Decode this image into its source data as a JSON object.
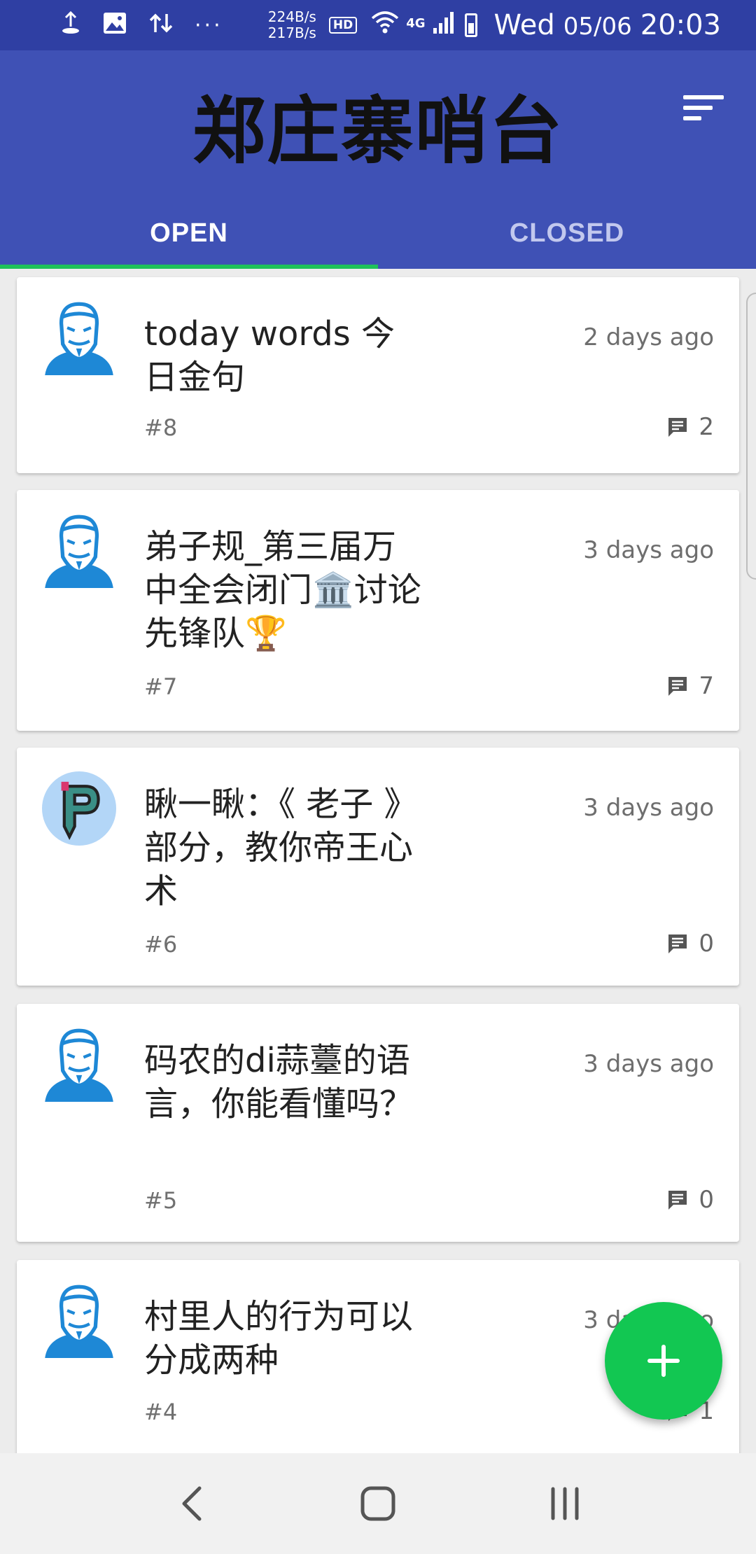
{
  "status_bar": {
    "net_up": "224B/s",
    "net_down": "217B/s",
    "hd_badge": "HD",
    "network": "4G",
    "day": "Wed",
    "date": "05/06",
    "time": "20:03",
    "icons": [
      "upload-icon",
      "image-icon",
      "data-transfer-icon",
      "more-dots-icon",
      "wifi-icon",
      "signal-icon",
      "battery-icon"
    ]
  },
  "header": {
    "title": "郑庄寨哨台",
    "sort_icon": "sort-icon"
  },
  "tabs": [
    {
      "label": "OPEN",
      "active": true
    },
    {
      "label": "CLOSED",
      "active": false
    }
  ],
  "issues": [
    {
      "title": "today words 今日金句",
      "time": "2 days ago",
      "number": "#8",
      "comments": "2",
      "avatar": "anonymous-mask"
    },
    {
      "title": "弟子规_第三届万中全会闭门🏛️讨论先锋队🏆",
      "time": "3 days ago",
      "number": "#7",
      "comments": "7",
      "avatar": "anonymous-mask"
    },
    {
      "title": " 瞅一瞅：《 老子 》部分，教你帝王心术",
      "time": "3 days ago",
      "number": "#6",
      "comments": "0",
      "avatar": "p-pencil"
    },
    {
      "title": "码农的di蒜薹的语言，你能看懂吗？",
      "time": "3 days ago",
      "number": "#5",
      "comments": "0",
      "avatar": "anonymous-mask"
    },
    {
      "title": "村里人的行为可以分成两种",
      "time": "3 days ago",
      "number": "#4",
      "comments": "1",
      "avatar": "anonymous-mask"
    }
  ],
  "fab": {
    "label": "+"
  },
  "colors": {
    "status_bar": "#2f3fa3",
    "app_bar": "#3f51b5",
    "tab_indicator": "#1fc15a",
    "fab": "#12c752",
    "avatar_blue": "#1e88d6"
  }
}
